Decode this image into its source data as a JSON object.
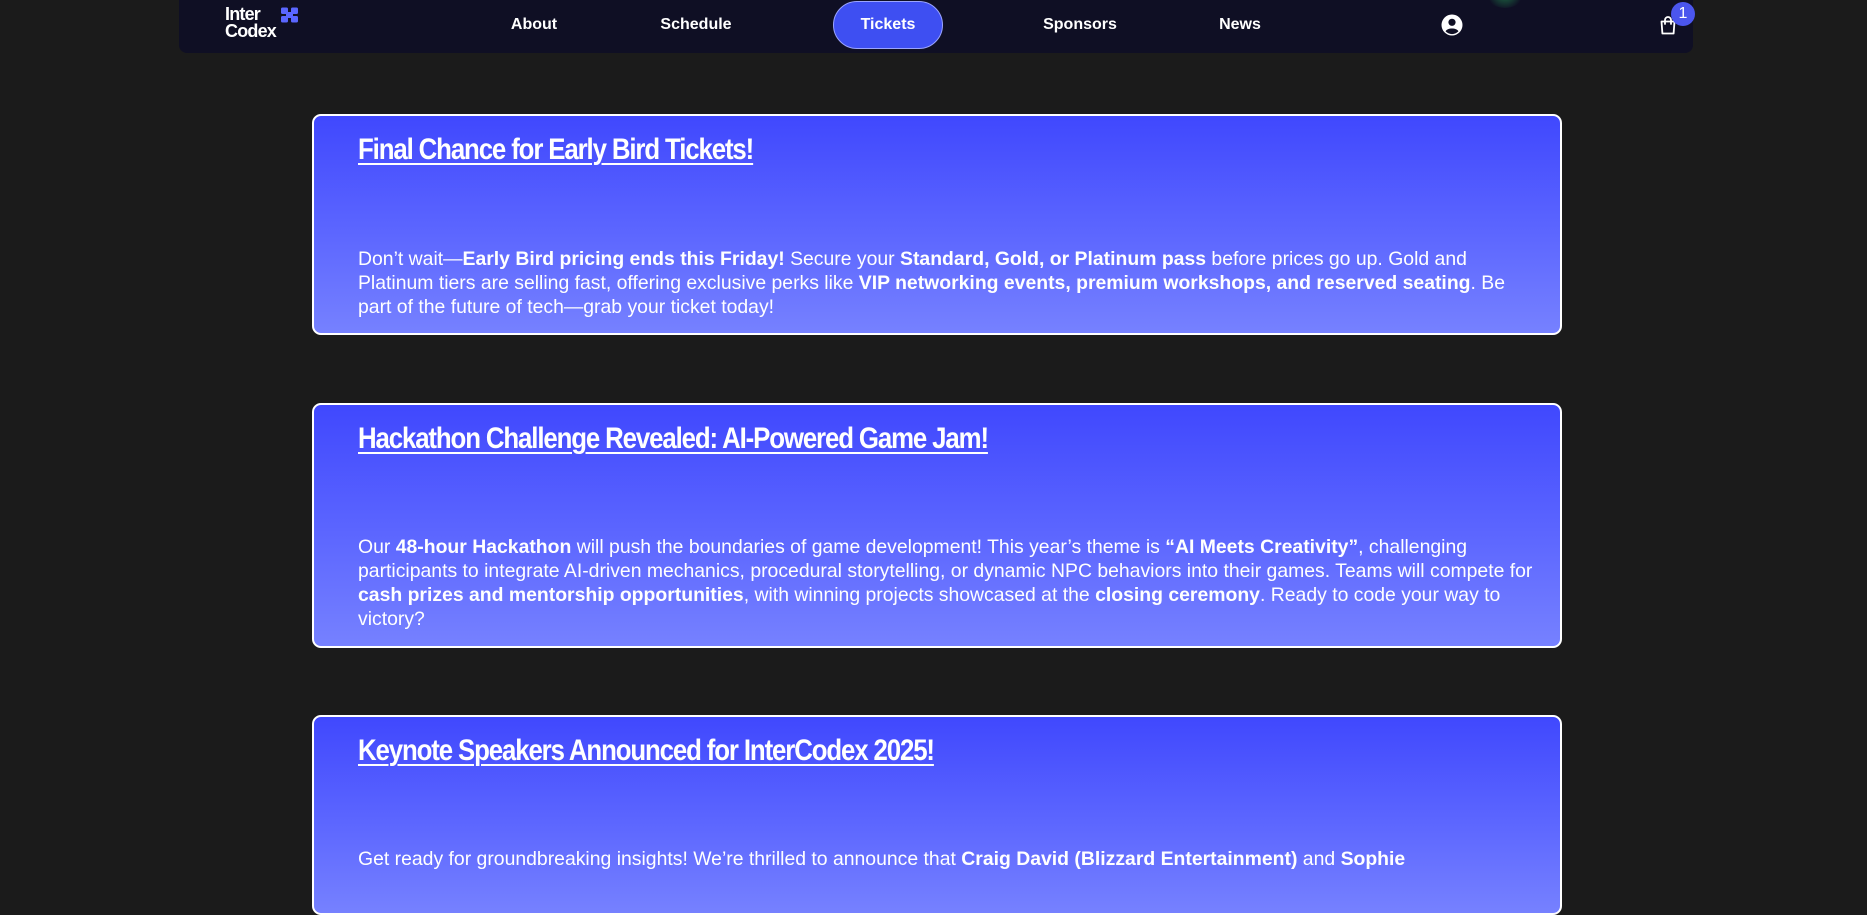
{
  "brand": {
    "logo_text_line1": "Inter",
    "logo_text_line2": "Codex"
  },
  "nav": {
    "links": [
      "About",
      "Schedule",
      "Tickets",
      "Sponsors",
      "News"
    ],
    "active": "Tickets",
    "cart_count": "1",
    "icons": [
      "user-circle-icon",
      "shopping-bag-icon"
    ]
  },
  "colors": {
    "page_background": "#1b1b1b",
    "nav_background": "#0f0f24",
    "accent": "#3e4ff2",
    "card_gradient_top": "#4048fe",
    "card_gradient_bottom": "#7681ff"
  },
  "news": [
    {
      "title": "Final Chance for Early Bird Tickets!",
      "body": [
        {
          "text": "Don’t wait—",
          "bold": false
        },
        {
          "text": "Early Bird pricing ends this Friday!",
          "bold": true
        },
        {
          "text": " Secure your ",
          "bold": false
        },
        {
          "text": "Standard, Gold, or Platinum pass",
          "bold": true
        },
        {
          "text": " before prices go up. Gold and Platinum tiers are selling fast, offering exclusive perks like ",
          "bold": false
        },
        {
          "text": "VIP networking events, premium workshops, and reserved seating",
          "bold": true
        },
        {
          "text": ". Be part of the future of tech—grab your ticket today!",
          "bold": false
        }
      ]
    },
    {
      "title": "Hackathon Challenge Revealed: AI-Powered Game Jam!",
      "body": [
        {
          "text": "Our ",
          "bold": false
        },
        {
          "text": "48-hour Hackathon",
          "bold": true
        },
        {
          "text": " will push the boundaries of game development! This year’s theme is ",
          "bold": false
        },
        {
          "text": "“AI Meets Creativity”",
          "bold": true
        },
        {
          "text": ", challenging participants to integrate AI-driven mechanics, procedural storytelling, or dynamic NPC behaviors into their games. Teams will compete for ",
          "bold": false
        },
        {
          "text": "cash prizes and mentorship opportunities",
          "bold": true
        },
        {
          "text": ", with winning projects showcased at the ",
          "bold": false
        },
        {
          "text": "closing ceremony",
          "bold": true
        },
        {
          "text": ". Ready to code your way to victory?",
          "bold": false
        }
      ]
    },
    {
      "title": "Keynote Speakers Announced for InterCodex 2025!",
      "body": [
        {
          "text": "Get ready for groundbreaking insights! We’re thrilled to announce that ",
          "bold": false
        },
        {
          "text": "Craig David (Blizzard Entertainment)",
          "bold": true
        },
        {
          "text": " and ",
          "bold": false
        },
        {
          "text": "Sophie",
          "bold": true
        }
      ]
    }
  ]
}
